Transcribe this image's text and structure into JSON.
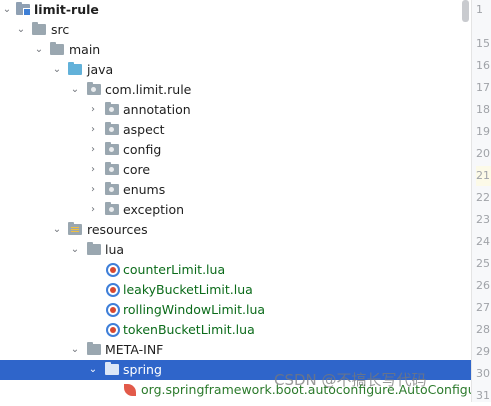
{
  "project_tree": {
    "root": "limit-rule",
    "src": "src",
    "main": "main",
    "java": "java",
    "package": "com.limit.rule",
    "subpackages": [
      "annotation",
      "aspect",
      "config",
      "core",
      "enums",
      "exception"
    ],
    "resources": "resources",
    "lua": "lua",
    "lua_files": [
      "counterLimit.lua",
      "leakyBucketLimit.lua",
      "rollingWindowLimit.lua",
      "tokenBucketLimit.lua"
    ],
    "meta_inf": "META-INF",
    "spring": "spring",
    "autoconfig_file": "org.springframework.boot.autoconfigure.AutoConfigurat"
  },
  "gutter": {
    "line_numbers": [
      "1",
      "15",
      "16",
      "17",
      "18",
      "19",
      "20",
      "21",
      "22",
      "23",
      "24",
      "25",
      "26",
      "27",
      "28",
      "29",
      "30",
      "31"
    ]
  },
  "watermark": "CSDN @不搞长写代码"
}
